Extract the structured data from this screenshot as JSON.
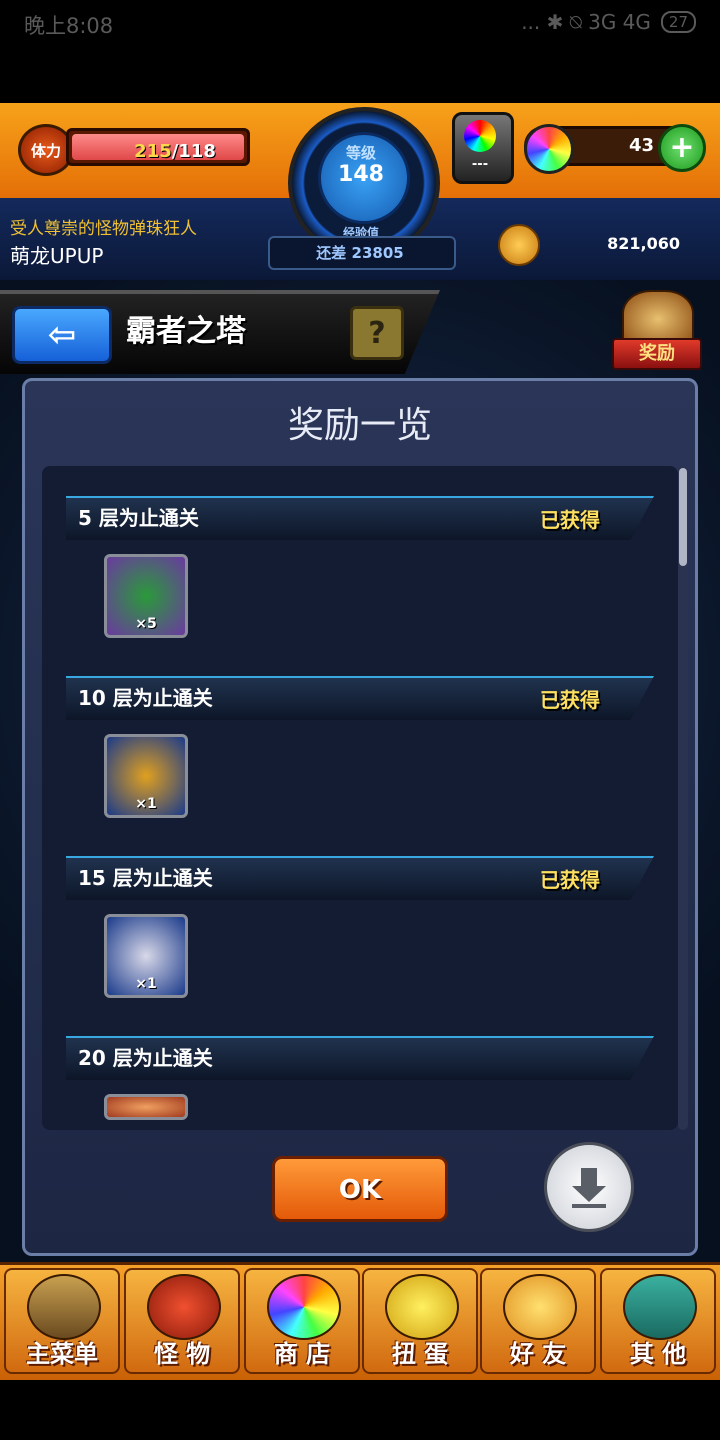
{
  "status_bar": {
    "time": "晚上8:08",
    "indicators": "... ✱ ⍉ 3G 4G",
    "battery": "27"
  },
  "header": {
    "stamina_label": "体力",
    "stamina_current": "215",
    "stamina_max": "/118",
    "level_label": "等级",
    "level_value": "148",
    "exp_label": "经验值",
    "exp_remaining": "还差 23805",
    "capsule_text": "---",
    "orb_count": "43",
    "orb_plus": "+",
    "player_title": "受人尊崇的怪物弹珠狂人",
    "player_name": "萌龙UPUP",
    "coin_count": "821,060"
  },
  "nav": {
    "back_glyph": "⇦",
    "title": "霸者之塔",
    "help": "?",
    "reward_badge": "奖励"
  },
  "modal": {
    "title": "奖励一览",
    "rows": [
      {
        "label": "5 层为止通关",
        "status": "已获得",
        "qty": "×5",
        "colors": [
          "#6a3aa0",
          "#2a9a3a"
        ]
      },
      {
        "label": "10 层为止通关",
        "status": "已获得",
        "qty": "×1",
        "colors": [
          "#1a3a8a",
          "#e0a020"
        ]
      },
      {
        "label": "15 层为止通关",
        "status": "已获得",
        "qty": "×1",
        "colors": [
          "#1a3a8a",
          "#d8d8e8"
        ]
      },
      {
        "label": "20 层为止通关",
        "status": "",
        "qty": "",
        "colors": [
          "#a03a20",
          "#f0a060"
        ]
      }
    ],
    "ok_label": "OK"
  },
  "bottom_nav": [
    {
      "label": "主菜单"
    },
    {
      "label": "怪 物"
    },
    {
      "label": "商 店"
    },
    {
      "label": "扭 蛋"
    },
    {
      "label": "好 友"
    },
    {
      "label": "其 他"
    }
  ]
}
